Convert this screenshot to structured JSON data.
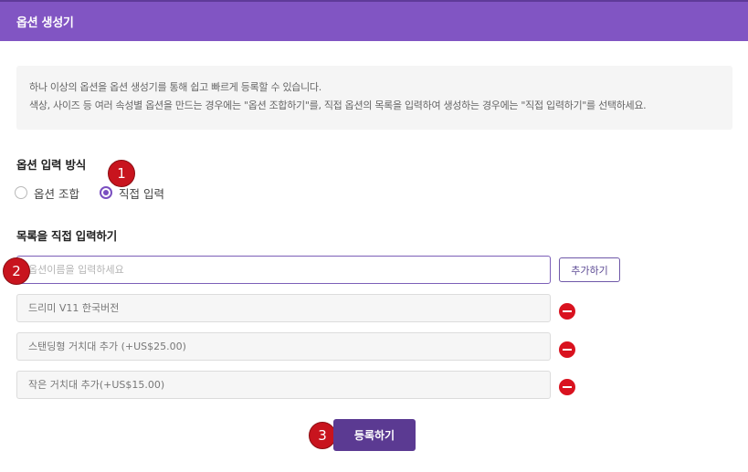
{
  "header": {
    "title": "옵션 생성기",
    "color": "#8155c3"
  },
  "notice": {
    "line1": "하나 이상의 옵션을 옵션 생성기를 통해 쉽고 빠르게 등록할 수 있습니다.",
    "line2": "색상, 사이즈 등 여러 속성별 옵션을 만드는 경우에는 \"옵션 조합하기\"를, 직접 옵션의 목록을 입력하여 생성하는 경우에는 \"직접 입력하기\"를 선택하세요."
  },
  "input_method": {
    "title": "옵션 입력 방식",
    "options": [
      {
        "label": "옵션 조합",
        "checked": false
      },
      {
        "label": "직접 입력",
        "checked": true
      }
    ]
  },
  "direct_input": {
    "title": "목록을 직접 입력하기",
    "placeholder": "옵션이름을 입력하세요",
    "value": "",
    "add_label": "추가하기",
    "items": [
      {
        "label": "드리미 V11 한국버전"
      },
      {
        "label": "스탠딩형 거치대 추가 (+US$25.00)"
      },
      {
        "label": "작은 거치대 추가(+US$15.00)"
      }
    ]
  },
  "submit_label": "등록하기",
  "step_badges": [
    "1",
    "2",
    "3"
  ],
  "icons": {
    "remove": "minus-circle-icon"
  },
  "colors": {
    "accent": "#5b3a92",
    "radio_checked": "#7a4fc0",
    "badge": "#c8141e",
    "remove": "#d9121f"
  }
}
